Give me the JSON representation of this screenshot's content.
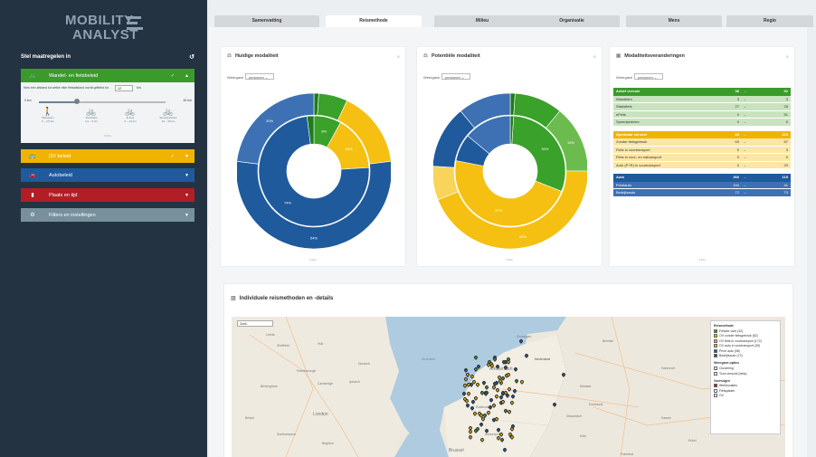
{
  "logo": {
    "line1": "MOBILITY",
    "line2": "ANALYST"
  },
  "sidebar": {
    "header": "Stel maatregelen in",
    "panels": [
      {
        "label": "Wandel- en fietsbeleid",
        "color": "#3a9b2a",
        "icon": "bike-icon"
      },
      {
        "label": "OV beleid",
        "color": "#f0b400",
        "icon": "bus-icon"
      },
      {
        "label": "Autobeleid",
        "color": "#1f5a9c",
        "icon": "car-icon"
      },
      {
        "label": "Plaats en tijd",
        "color": "#b11e25",
        "icon": "building-icon"
      },
      {
        "label": "Filters en instellingen",
        "color": "#78909c",
        "icon": "gear-icon"
      }
    ],
    "walk": {
      "question": "Kies een afstand tot welke elke fietsafstand wordt gefietst tot",
      "input_value": "12",
      "unit": "km",
      "slider_min": "0 km",
      "slider_max": "40 km",
      "slider_value_fraction": 0.3,
      "modes": [
        {
          "name": "Wandelen",
          "range": "0 – 2,5 km",
          "glyph": "🚶"
        },
        {
          "name": "Stadsfiets",
          "range": "1,5 – 5 km",
          "glyph": "🚲"
        },
        {
          "name": "E-fiets",
          "range": "2 – 12 km",
          "glyph": "🚲"
        },
        {
          "name": "Speedpedelec",
          "range": "10 – 40 km",
          "glyph": "🚲"
        }
      ],
      "more": "▾ Info"
    }
  },
  "tabs": [
    "Samenvatting",
    "Reismethode",
    "Milieu",
    "Organisatie",
    "Mens",
    "Regio"
  ],
  "active_tab": 1,
  "cards": {
    "huidige": {
      "title": "Huidige modaliteit",
      "weergave_label": "Weergave",
      "weergave_value": "personen",
      "more": "▾ Info"
    },
    "potentiele": {
      "title": "Potentiële modaliteit",
      "weergave_label": "Weergave",
      "weergave_value": "personen",
      "more": "▾ Info"
    },
    "veranderingen": {
      "title": "Modaliteitsveranderingen",
      "weergave_label": "Weergave",
      "weergave_value": "personen",
      "more": "▾ Info"
    }
  },
  "colors": {
    "green": "#3aa12a",
    "green_light": "#6cbb4e",
    "yellow": "#f5c012",
    "yellow_light": "#f8d45a",
    "blue": "#1f5a9c",
    "blue_light": "#3e71b3"
  },
  "chart_data": [
    {
      "type": "pie",
      "title": "Huidige modaliteit",
      "outer": [
        {
          "label": "",
          "value": 1,
          "color": "#1f7a1f"
        },
        {
          "label": "",
          "value": 6,
          "color": "#3aa12a"
        },
        {
          "label": "",
          "value": 16,
          "color": "#f5c012"
        },
        {
          "label": "",
          "value": 54,
          "color": "#1f5a9c"
        },
        {
          "label": "",
          "value": 23,
          "color": "#3e71b3"
        }
      ],
      "inner": [
        {
          "label": "8%",
          "value": 8,
          "color": "#3aa12a"
        },
        {
          "label": "16%",
          "value": 16,
          "color": "#f5c012"
        },
        {
          "label": "74%",
          "value": 74,
          "color": "#1f5a9c"
        },
        {
          "label": "",
          "value": 2,
          "color": "#1f7a1f"
        }
      ],
      "outer_labels": [
        "",
        "",
        "",
        "54%",
        "20%"
      ]
    },
    {
      "type": "pie",
      "title": "Potentiële modaliteit",
      "outer": [
        {
          "label": "",
          "value": 1,
          "color": "#1f7a1f"
        },
        {
          "label": "",
          "value": 10,
          "color": "#3aa12a"
        },
        {
          "label": "",
          "value": 14,
          "color": "#6cbb4e"
        },
        {
          "label": "",
          "value": 44,
          "color": "#f5c012"
        },
        {
          "label": "",
          "value": 7,
          "color": "#f8d45a"
        },
        {
          "label": "",
          "value": 13,
          "color": "#1f5a9c"
        },
        {
          "label": "",
          "value": 11,
          "color": "#3e71b3"
        }
      ],
      "inner": [
        {
          "label": "",
          "value": 1,
          "color": "#1f7a1f"
        },
        {
          "label": "30%",
          "value": 30,
          "color": "#3aa12a"
        },
        {
          "label": "47%",
          "value": 47,
          "color": "#f5c012"
        },
        {
          "label": "",
          "value": 8,
          "color": "#1f5a9c"
        },
        {
          "label": "",
          "value": 14,
          "color": "#3e71b3"
        }
      ],
      "outer_labels": [
        "",
        "",
        "14%",
        "15%",
        "",
        "",
        ""
      ]
    }
  ],
  "table": {
    "groups": [
      {
        "title": "Actief vervoer",
        "value": "38",
        "arrow": "→",
        "result": "92",
        "color": "#3a9b2a",
        "rowbg": "#c9e3bf",
        "rows": [
          {
            "label": "Wandelen",
            "value": "3",
            "arrow": "→",
            "result": "3"
          },
          {
            "label": "Stadsfiets",
            "value": "27",
            "arrow": "→",
            "result": "28"
          },
          {
            "label": "eFiets",
            "value": "0",
            "arrow": "→",
            "result": "51"
          },
          {
            "label": "Speedpedelec",
            "value": "0",
            "arrow": "→",
            "result": "0"
          }
        ]
      },
      {
        "title": "Openbaar vervoer",
        "value": "63",
        "arrow": "→",
        "result": "113",
        "color": "#f0b400",
        "rowbg": "#fbe6a6",
        "rows": [
          {
            "label": "Zonder fietsgebruik",
            "value": "63",
            "arrow": "→",
            "result": "57"
          },
          {
            "label": "Fiets in voortransport",
            "value": "0",
            "arrow": "→",
            "result": "3"
          },
          {
            "label": "Fiets in voor- en natransport",
            "value": "0",
            "arrow": "→",
            "result": "0"
          },
          {
            "label": "Auto (P+R) in voortransport",
            "value": "0",
            "arrow": "→",
            "result": "20"
          }
        ]
      },
      {
        "title": "Auto",
        "value": "266",
        "arrow": "→",
        "result": "115",
        "color": "#1f5a9c",
        "rowbg": "#3e71b3",
        "rows": [
          {
            "label": "Privéauto",
            "value": "194",
            "arrow": "→",
            "result": "41"
          },
          {
            "label": "Bedrijfsauto",
            "value": "72",
            "arrow": "→",
            "result": "73"
          }
        ]
      }
    ]
  },
  "map": {
    "title": "Individuele reismethoden en -details",
    "search_placeholder": "Zoek",
    "labels": [
      "Leeds",
      "Sheffield",
      "Hull",
      "Peterborough",
      "Norwich",
      "Birmingham",
      "Cambridge",
      "Ipswich",
      "London",
      "Southampton",
      "Brighton",
      "Bristol",
      "Noordzee",
      "Groningen",
      "Amsterdam",
      "Nederland",
      "Rotterdam",
      "Antwerpen",
      "Brussel",
      "Dortmund",
      "Düsseldorf",
      "Köln",
      "Hannover",
      "Magdeburg",
      "Leipzig",
      "Kassel",
      "Erfurt",
      "Frankfurt",
      "Bremen",
      "Münster"
    ],
    "legend": {
      "h1": "Reismethode",
      "items1": [
        {
          "label": "Fiets/te voet (32)",
          "color": "#3aa12a"
        },
        {
          "label": "OV zonder fietsgebruik (52)",
          "color": "#f0b400"
        },
        {
          "label": "OV fiets in voortransport (172)",
          "color": "#f0b400"
        },
        {
          "label": "OV auto in voortransport (39)",
          "color": "#f0b400"
        },
        {
          "label": "Privé auto (98)",
          "color": "#1f5a9c"
        },
        {
          "label": "Bedrijfsauto (72)",
          "color": "#1f5a9c"
        }
      ],
      "h2": "Weergave-opties",
      "items2": [
        {
          "label": "Clustering"
        },
        {
          "label": "Toon verschil (beta)"
        }
      ],
      "h3": "Voertuigen",
      "items3": [
        {
          "label": "Werklocaties",
          "color": "#b11e25"
        },
        {
          "label": "Fietspaden",
          "color": ""
        },
        {
          "label": "OV",
          "color": ""
        }
      ]
    }
  }
}
